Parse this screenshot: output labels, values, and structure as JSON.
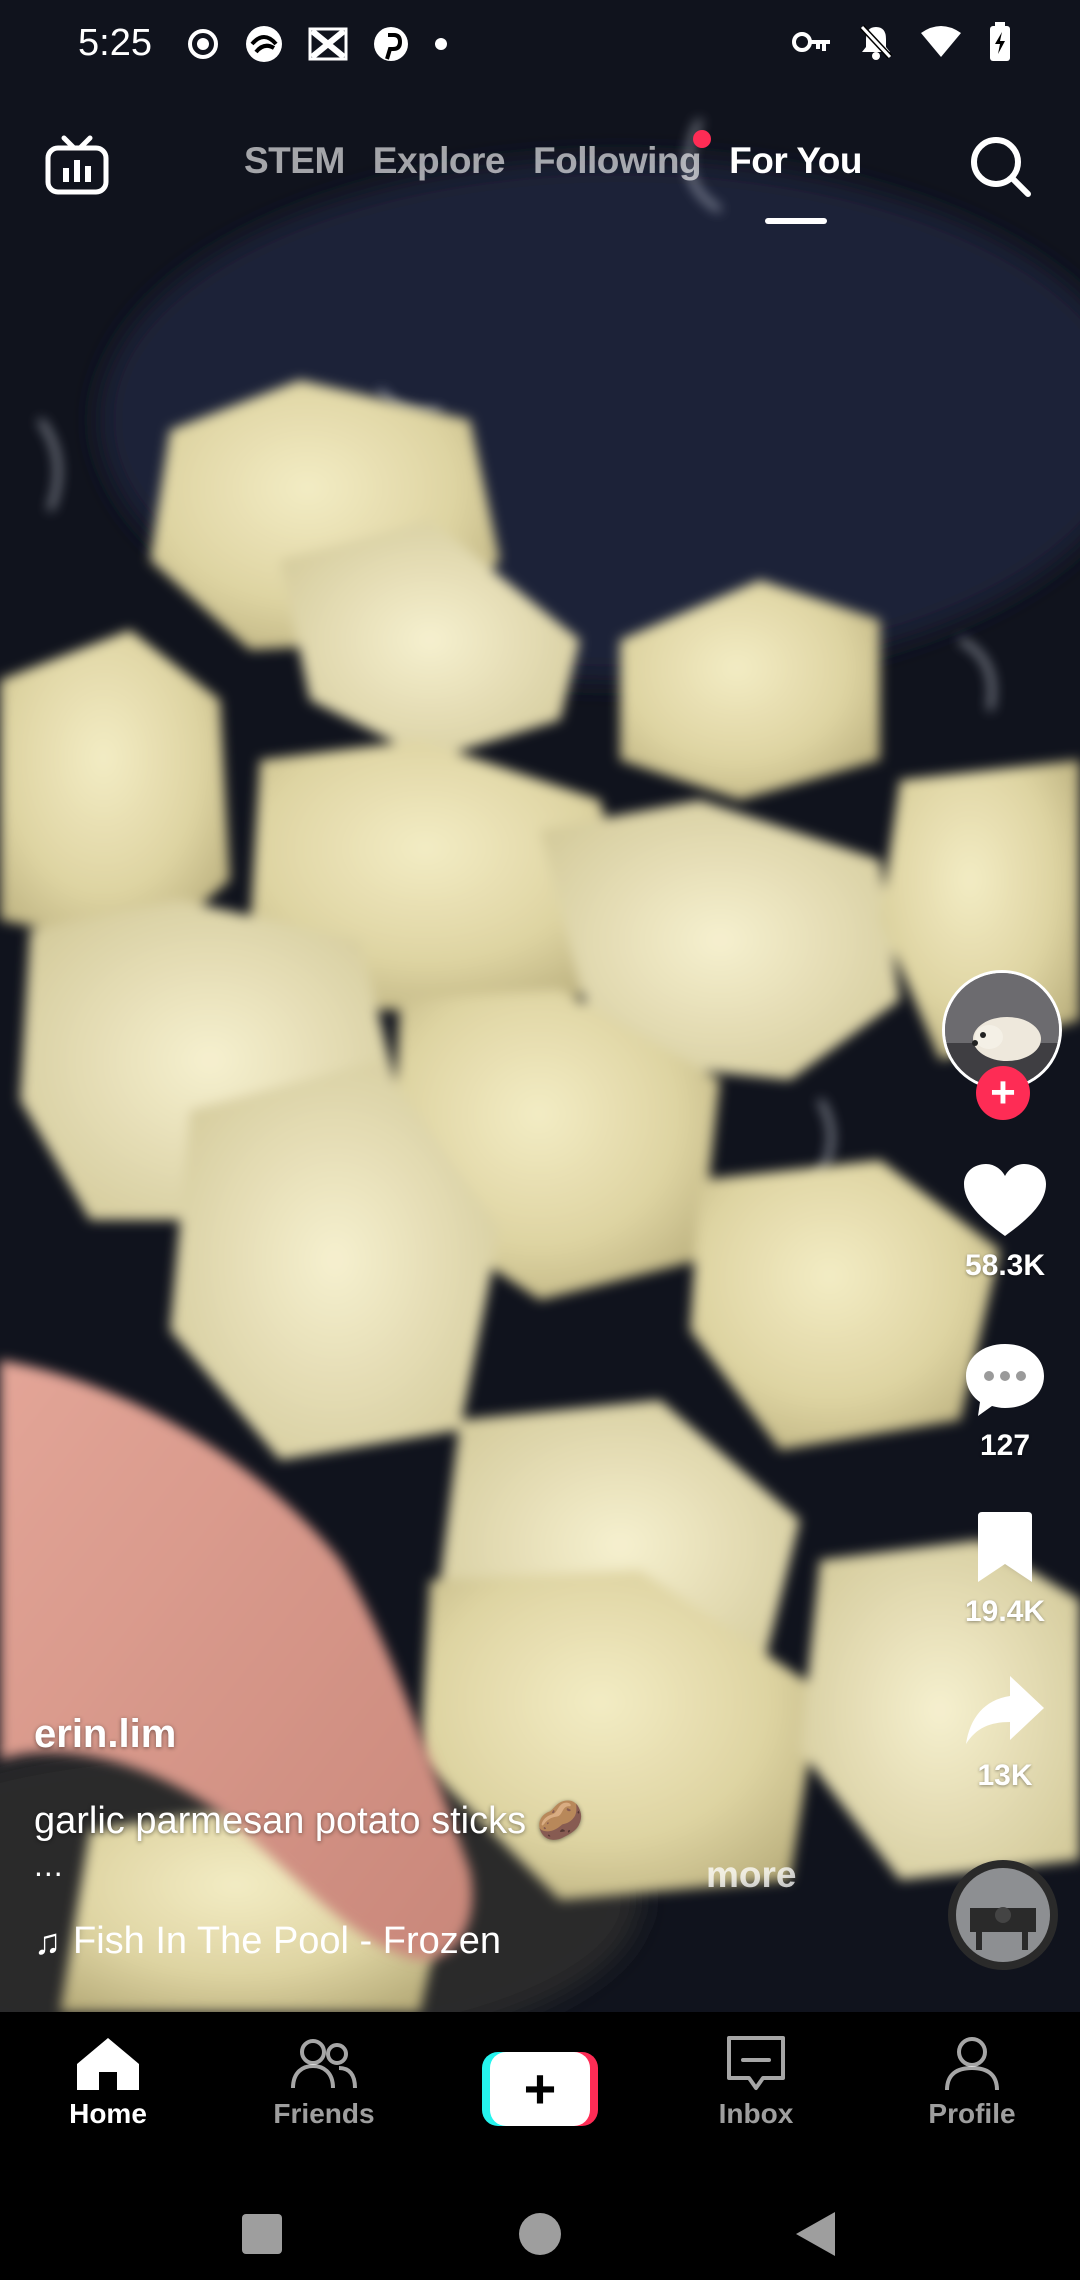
{
  "status_bar": {
    "time": "5:25"
  },
  "top_tabs": [
    {
      "label": "STEM",
      "active": false,
      "has_dot": false
    },
    {
      "label": "Explore",
      "active": false,
      "has_dot": false
    },
    {
      "label": "Following",
      "active": false,
      "has_dot": true
    },
    {
      "label": "For You",
      "active": true,
      "has_dot": false
    }
  ],
  "rail": {
    "likes": "58.3K",
    "comments": "127",
    "saves": "19.4K",
    "shares": "13K"
  },
  "caption": {
    "username": "erin.lim",
    "description": "garlic parmesan potato sticks 🥔",
    "ellipsis": "...",
    "more": "more",
    "music": "Fish In The Pool - Frozen"
  },
  "bottom_nav": {
    "home": "Home",
    "friends": "Friends",
    "inbox": "Inbox",
    "profile": "Profile",
    "create": "+"
  },
  "colors": {
    "accent": "#fe2c55",
    "cyan": "#25f4ee",
    "background": "#000000"
  },
  "icons": {
    "live": "tv-icon",
    "search": "search-icon",
    "like": "heart-icon",
    "comment": "comment-bubble-icon",
    "save": "bookmark-icon",
    "share": "share-arrow-icon",
    "home": "home-icon",
    "friends": "friends-icon",
    "inbox": "inbox-icon",
    "profile": "profile-icon"
  }
}
